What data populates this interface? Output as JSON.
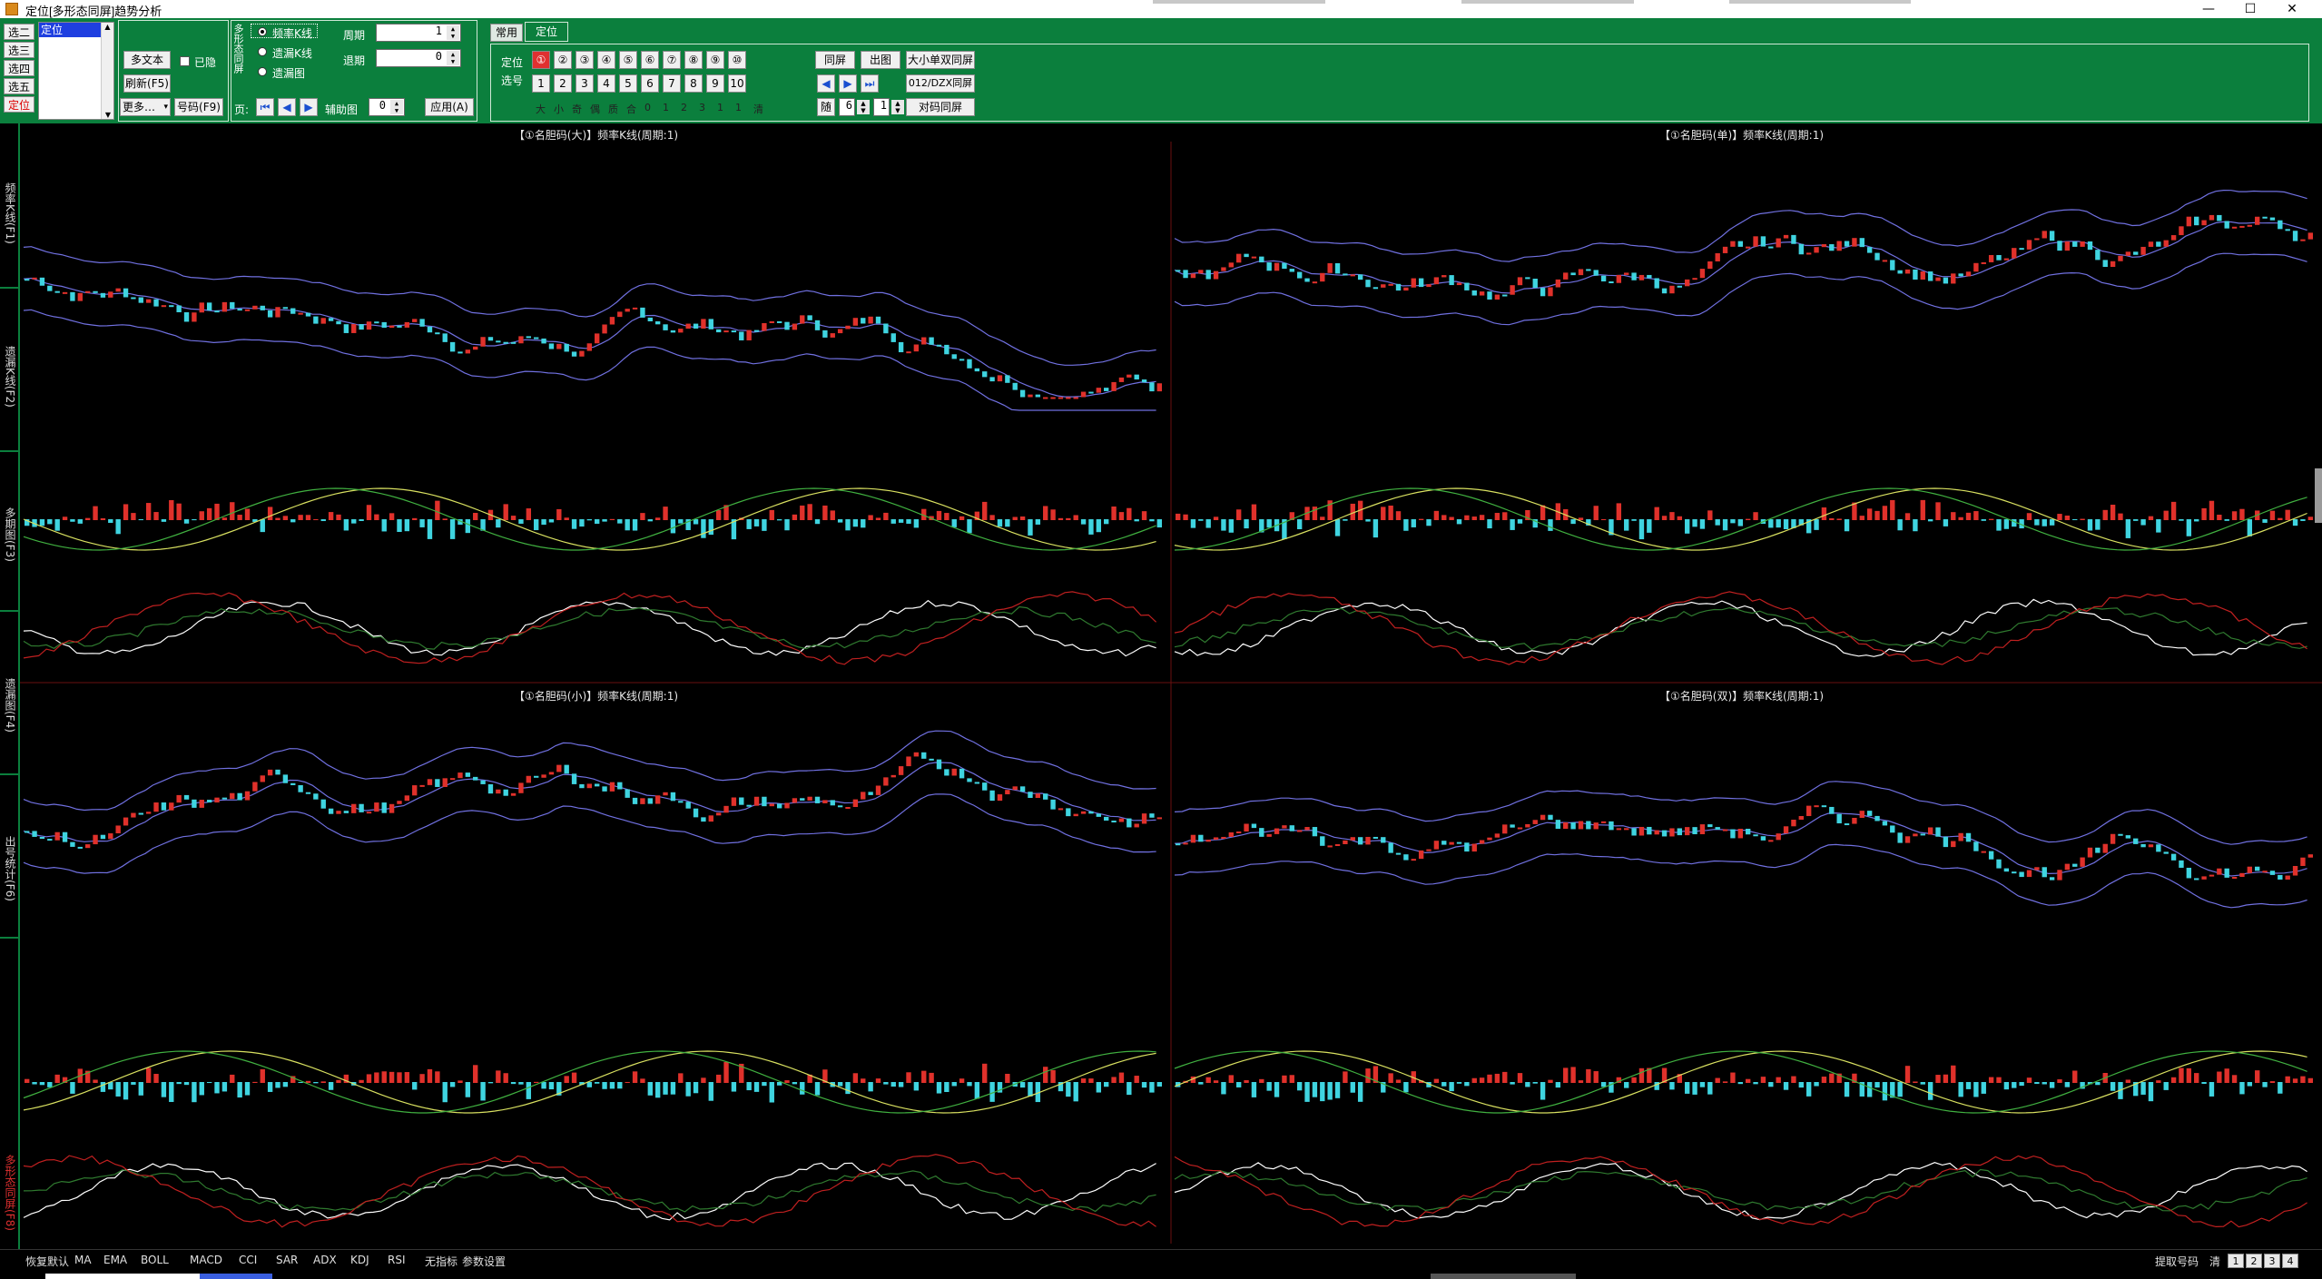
{
  "window": {
    "title": "定位[多形态同屏]趋势分析",
    "controls": {
      "minimize": "—",
      "maximize": "☐",
      "close": "✕"
    }
  },
  "left_panel": {
    "nav_buttons": [
      "选二",
      "选三",
      "选四",
      "选五",
      "定位"
    ],
    "list": {
      "selected_item": "定位"
    },
    "multitext_button": "多文本",
    "hide_checkbox_label": "已隐",
    "refresh_button": "刷新(F5)",
    "more_select": "更多…",
    "number_button": "号码(F9)"
  },
  "mode_panel": {
    "vertical_label": "多形态同屏",
    "radio_options": [
      "频率K线",
      "遗漏K线",
      "遗漏图"
    ],
    "selected_option": "频率K线",
    "period_label": "周期",
    "period_value": "1",
    "back_label": "退期",
    "back_value": "0",
    "page_label": "页:",
    "assist_label": "辅助图",
    "assist_value": "0",
    "apply_button": "应用(A)"
  },
  "tabs": [
    "常用",
    "定位"
  ],
  "active_tab": "定位",
  "position_panel": {
    "position_label": "定位",
    "position_buttons": [
      "①",
      "②",
      "③",
      "④",
      "⑤",
      "⑥",
      "⑦",
      "⑧",
      "⑨",
      "⑩"
    ],
    "active_position": "①",
    "number_label": "选号",
    "number_buttons": [
      "1",
      "2",
      "3",
      "4",
      "5",
      "6",
      "7",
      "8",
      "9",
      "10"
    ],
    "filter_labels": [
      "大",
      "小",
      "奇",
      "偶",
      "质",
      "合",
      "0",
      "1",
      "2",
      "3",
      "1",
      "1",
      "清"
    ],
    "same_screen_button": "同屏",
    "draw_button": "出图",
    "size_odd_same_button": "大小单双同屏",
    "mod_same_button": "012/DZX同屏",
    "code_same_button": "对码同屏",
    "random_label": "随",
    "random_value": "6",
    "random_count": "1"
  },
  "side_tabs": [
    {
      "label": "频率K线(F1)",
      "active": false
    },
    {
      "label": "遗漏K线(F2)",
      "active": false
    },
    {
      "label": "多期图(F3)",
      "active": false
    },
    {
      "label": "遗漏图(F4)",
      "active": false
    },
    {
      "label": "出号统计(F6)",
      "active": false
    },
    {
      "label": "多形态同屏(F8)",
      "active": true
    }
  ],
  "panes": [
    {
      "title": "【①名胆码(大)】频率K线(周期:1)"
    },
    {
      "title": "【①名胆码(单)】频率K线(周期:1)"
    },
    {
      "title": "【①名胆码(小)】频率K线(周期:1)"
    },
    {
      "title": "【①名胆码(双)】频率K线(周期:1)"
    }
  ],
  "colors": {
    "toolbar_bg": "#0b7f3d",
    "candle_up": "#e0312b",
    "candle_down": "#3fd4e0",
    "boll_band": "#7070e0",
    "macd_dif": "#d8e060",
    "macd_dea": "#40b040",
    "kdj_k": "#ffffff",
    "kdj_d": "#2f7a2f",
    "kdj_j": "#c02020"
  },
  "statusbar": {
    "items": [
      "恢复默认",
      "MA",
      "EMA",
      "BOLL",
      "MACD",
      "CCI",
      "SAR",
      "ADX",
      "KDJ",
      "RSI",
      "无指标",
      "参数设置"
    ],
    "extract_label": "提取号码",
    "clear_label": "清",
    "pages": [
      "1",
      "2",
      "3",
      "4"
    ]
  }
}
